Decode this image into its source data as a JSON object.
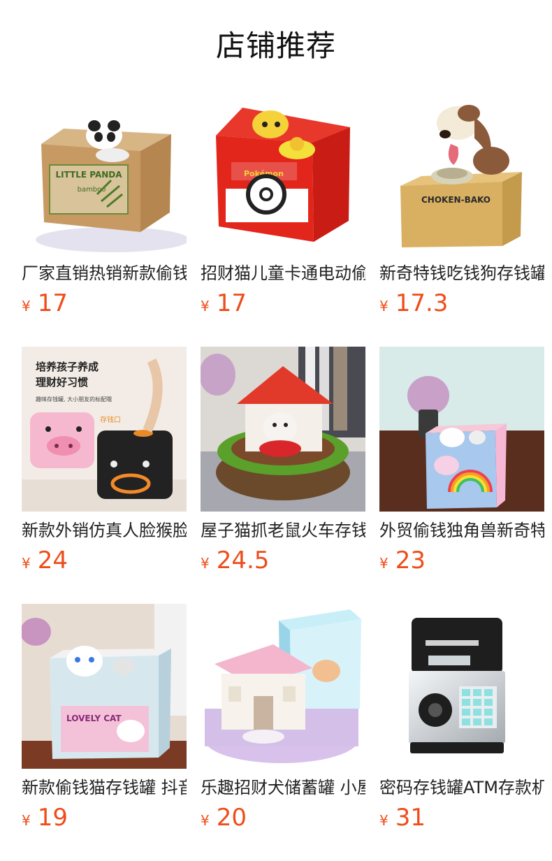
{
  "header": {
    "title": "店铺推荐"
  },
  "currency_symbol": "¥",
  "accent_color": "#ee4d1a",
  "products": [
    {
      "name": "厂家直销热销新款偷钱熊猫存钱罐",
      "price": "17"
    },
    {
      "name": "招财猫儿童卡通电动偷钱存钱罐",
      "price": "17"
    },
    {
      "name": "新奇特钱吃钱狗存钱罐",
      "price": "17.3"
    },
    {
      "name": "新款外销仿真人脸猴脸存钱罐",
      "price": "24"
    },
    {
      "name": "屋子猫抓老鼠火车存钱罐",
      "price": "24.5"
    },
    {
      "name": "外贸偷钱独角兽新奇特存钱罐",
      "price": "23"
    },
    {
      "name": "新款偷钱猫存钱罐 抖音同款",
      "price": "19"
    },
    {
      "name": "乐趣招财犬储蓄罐 小屋",
      "price": "20"
    },
    {
      "name": "密码存钱罐ATM存款机",
      "price": "31"
    }
  ],
  "product_images": [
    {
      "label": "LITTLE PANDA",
      "sublabel": "bamboo",
      "icon": "panda-coin-box-image"
    },
    {
      "label": "Pokémon",
      "icon": "pikachu-coin-box-image"
    },
    {
      "label": "CHOKEN-BAKO",
      "icon": "dog-coin-bank-image"
    },
    {
      "label": "培养孩子养成",
      "label2": "理财好习惯",
      "sublabel": "趣味存钱罐, 大小朋友的标配哦",
      "tag": "存钱口",
      "icon": "face-coin-bank-image"
    },
    {
      "icon": "cat-house-bank-image"
    },
    {
      "icon": "unicorn-coin-box-image"
    },
    {
      "label": "LOVELY CAT",
      "icon": "cat-coin-box-image"
    },
    {
      "icon": "dog-house-bank-image"
    },
    {
      "icon": "atm-safe-bank-image"
    }
  ]
}
